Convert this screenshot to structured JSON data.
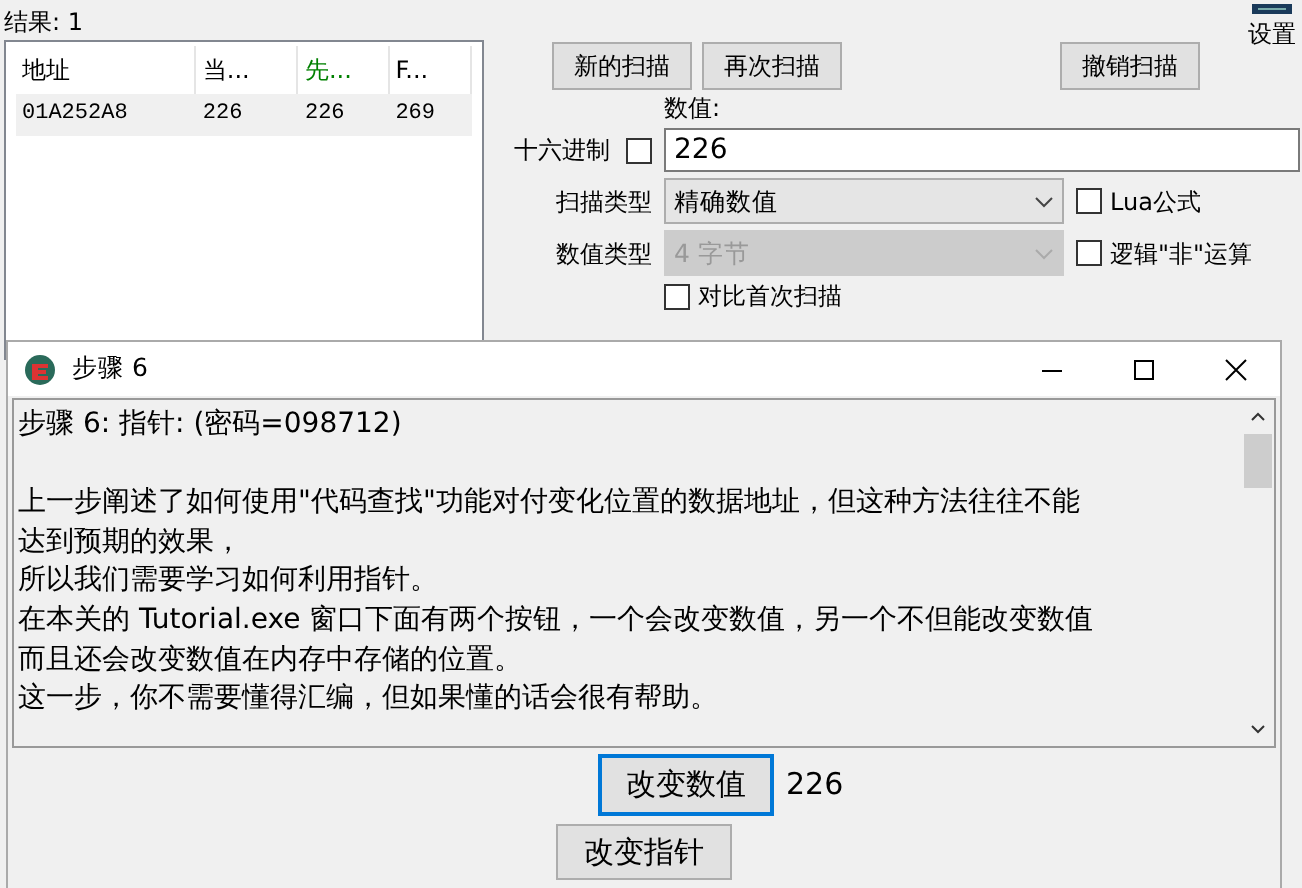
{
  "main_window": {
    "results_label": "结果: 1",
    "settings_label": "设置",
    "columns": [
      {
        "label": "地址",
        "color": "#000000"
      },
      {
        "label": "当...",
        "color": "#000000"
      },
      {
        "label": "先...",
        "color": "#008000"
      },
      {
        "label": "F...",
        "color": "#000000"
      }
    ],
    "rows": [
      {
        "cells": [
          "01A252A8",
          "226",
          "226",
          "269"
        ]
      }
    ],
    "buttons": [
      "新的扫描",
      "再次扫描",
      "撤销扫描"
    ],
    "value_label": "数值:",
    "hex": {
      "label": "十六进制",
      "checked": false
    },
    "value": "226",
    "scan_type": {
      "label": "扫描类型",
      "value": "精确数值",
      "disabled": false
    },
    "value_type": {
      "label": "数值类型",
      "value": "4 字节",
      "disabled": true
    },
    "options": [
      {
        "label": "Lua公式",
        "checked": false
      },
      {
        "label": "逻辑\"非\"运算",
        "checked": false
      }
    ],
    "compare_first": {
      "label": "对比首次扫描",
      "checked": false
    }
  },
  "dialog": {
    "title": "步骤 6",
    "heading": "步骤 6: 指针: (密码=098712)",
    "lines": [
      "上一步阐述了如何使用\"代码查找\"功能对付变化位置的数据地址，但这种方法往往不能",
      "达到预期的效果，",
      "所以我们需要学习如何利用指针。",
      "在本关的 Tutorial.exe 窗口下面有两个按钮，一个会改变数值，另一个不但能改变数值",
      "而且还会改变数值在内存中存储的位置。",
      "这一步，你不需要懂得汇编，但如果懂的话会很有帮助。"
    ],
    "buttons": [
      {
        "label": "改变数值",
        "focused": true
      },
      {
        "label": "改变指针",
        "focused": false
      }
    ],
    "value": "226"
  }
}
